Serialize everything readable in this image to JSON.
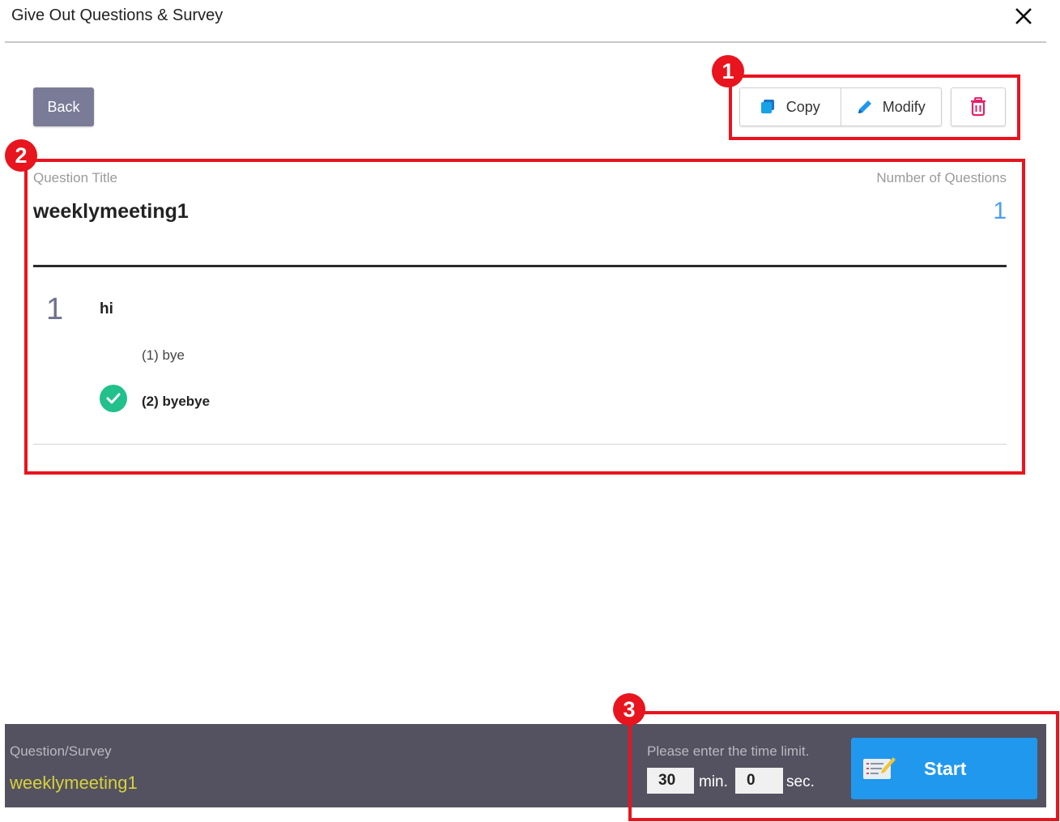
{
  "dialog": {
    "title": "Give Out Questions & Survey",
    "close_icon": "close-icon"
  },
  "toolbar": {
    "back_label": "Back",
    "copy_label": "Copy",
    "modify_label": "Modify",
    "delete_icon": "trash-icon"
  },
  "annotations": {
    "badge_1": "1",
    "badge_2": "2",
    "badge_3": "3",
    "highlight_color": "#e8141e"
  },
  "question_set": {
    "title_label": "Question Title",
    "title": "weeklymeeting1",
    "count_label": "Number of Questions",
    "count": "1",
    "questions": [
      {
        "number": "1",
        "text": "hi",
        "options": [
          {
            "label": "(1) bye",
            "correct": false
          },
          {
            "label": "(2) byebye",
            "correct": true
          }
        ]
      }
    ]
  },
  "footer": {
    "label": "Question/Survey",
    "value": "weeklymeeting1",
    "time_label": "Please enter the time limit.",
    "minutes": "30",
    "minutes_unit": "min.",
    "seconds": "0",
    "seconds_unit": "sec.",
    "start_label": "Start"
  },
  "colors": {
    "accent": "#1f98ee",
    "back_button": "#7a7b97",
    "correct": "#22c08a",
    "count": "#4c9ff0",
    "footer_bg": "#545260",
    "footer_value": "#d7d13c"
  }
}
